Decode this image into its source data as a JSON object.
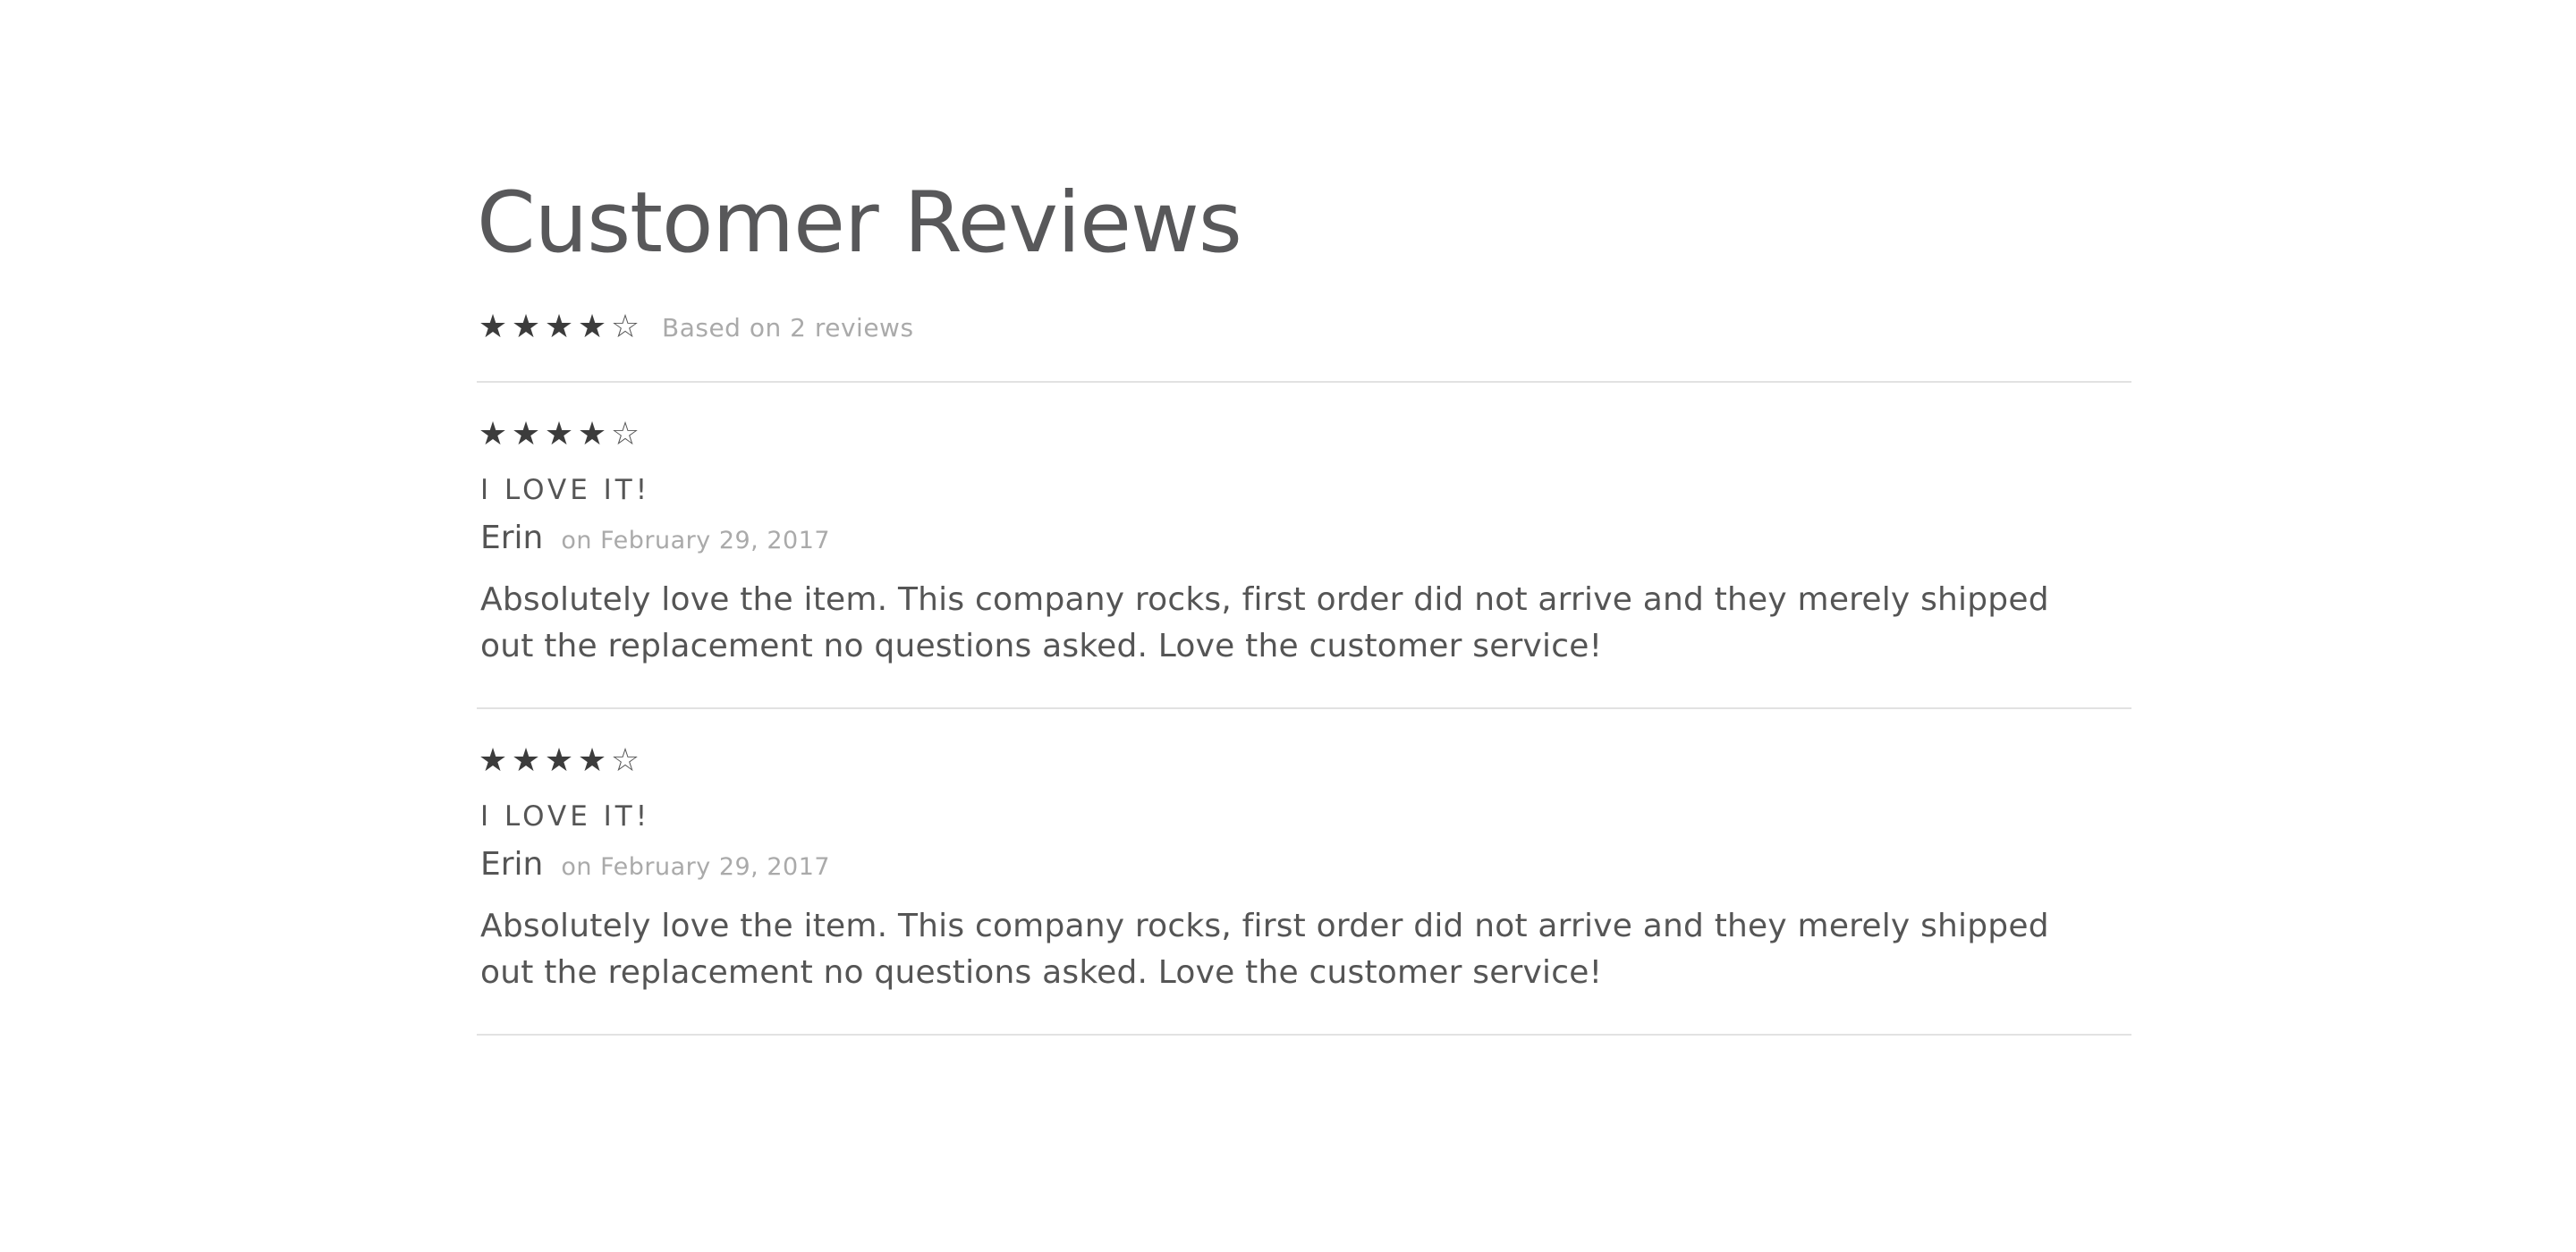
{
  "page": {
    "title": "Customer Reviews"
  },
  "summary": {
    "rating_out_of_5": 4,
    "text": "Based on 2 reviews"
  },
  "star_glyphs": {
    "filled": "★",
    "empty": "☆"
  },
  "reviews": [
    {
      "rating_out_of_5": 4,
      "title": "I LOVE IT!",
      "author": "Erin",
      "date": "on February 29, 2017",
      "body": "Absolutely love the item. This company rocks, first order did not arrive and they merely shipped out the replacement no questions asked. Love the customer service!"
    },
    {
      "rating_out_of_5": 4,
      "title": "I LOVE IT!",
      "author": "Erin",
      "date": "on February 29, 2017",
      "body": "Absolutely love the item. This company rocks, first order did not arrive and they merely shipped out the replacement no questions asked. Love the customer service!"
    }
  ],
  "colors": {
    "text": "#555555",
    "muted": "#aaaaaa",
    "star": "#3c3c3c",
    "divider": "#e2e2e2"
  }
}
